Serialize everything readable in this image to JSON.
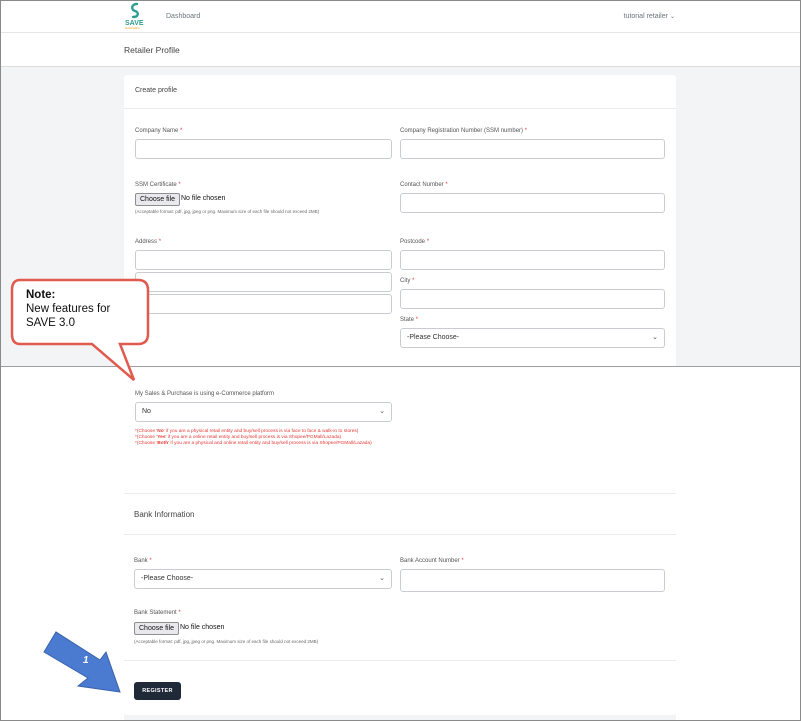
{
  "nav": {
    "logo_text": "SAVE",
    "logo_subtext": "Sustainability",
    "dashboard": "Dashboard",
    "user": "tutorial retailer"
  },
  "page": {
    "title": "Retailer Profile"
  },
  "form": {
    "section_title": "Create profile",
    "company_name_label": "Company Name",
    "reg_number_label": "Company Registration Number (SSM number)",
    "ssm_cert_label": "SSM Certificate",
    "contact_label": "Contact Number",
    "file_button": "Choose file",
    "file_status": "No file chosen",
    "file_hint": "(Acceptable format: pdf, jpg, jpeg or png. Maximum size of each file should not exceed 2MB)",
    "address_label": "Address",
    "postcode_label": "Postcode",
    "city_label": "City",
    "state_label": "State",
    "state_value": "-Please Choose-",
    "ecommerce_label": "My Sales & Purchase is using e-Commerce platform",
    "ecommerce_value": "No",
    "ecom_hint_1_pre": "*(Choose '",
    "ecom_hint_1_bold": "No",
    "ecom_hint_1_post": "' if you are a physical retail entity and buy/sell process is via face to face & walk-in to stores)",
    "ecom_hint_2_pre": "*(Choose '",
    "ecom_hint_2_bold": "Yes",
    "ecom_hint_2_post": "' if you are a online retail entity and buy/sell process is via Shopee/PGMall/Lazada)",
    "ecom_hint_3_pre": "*(Choose '",
    "ecom_hint_3_bold": "Both",
    "ecom_hint_3_post": "' if you are a physical and online retail entity and buy/sell process is via Shopee/PGMall/Lazada)",
    "required_mark": "*"
  },
  "bank": {
    "section_title": "Bank Information",
    "bank_label": "Bank",
    "bank_value": "-Please Choose-",
    "account_label": "Bank Account Number",
    "statement_label": "Bank Statement",
    "file_button": "Choose file",
    "file_status": "No file chosen",
    "file_hint": "(Acceptable format: pdf, jpg, jpeg or png. Maximum size of each file should not exceed 2MB)"
  },
  "actions": {
    "register": "REGISTER"
  },
  "annotations": {
    "note_title": "Note:",
    "note_line1": "New features for",
    "note_line2": "SAVE 3.0",
    "step_number": "1"
  },
  "colors": {
    "required": "#e53935",
    "button_dark": "#1f2937",
    "callout_border": "#e05a4e",
    "arrow_fill": "#4a7bd0"
  }
}
